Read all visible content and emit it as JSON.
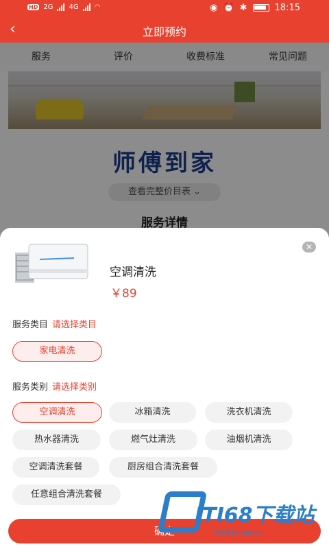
{
  "status_bar": {
    "left_badges": [
      "HD",
      "2G",
      "4G"
    ],
    "time": "18:15"
  },
  "header": {
    "title": "立即预约",
    "back_icon": "chevron-left-icon"
  },
  "tabs": [
    "服务",
    "评价",
    "收费标准",
    "常见问题"
  ],
  "background": {
    "brand_title": "师傅到家",
    "view_list_label": "查看完整价目表 ⌄",
    "section_title": "服务详情"
  },
  "sheet": {
    "product_name": "空调清洗",
    "price": "￥89",
    "category_label": "服务类目",
    "category_hint": "请选择类目",
    "categories": [
      "家电清洗"
    ],
    "type_label": "服务类别",
    "type_hint": "请选择类别",
    "types": [
      "空调清洗",
      "冰箱清洗",
      "洗衣机清洗",
      "热水器清洗",
      "燃气灶清洗",
      "油烟机清洗",
      "空调清洗套餐",
      "厨房组合清洗套餐",
      "任意组合清洗套餐"
    ],
    "selected_type": "空调清洗",
    "confirm_label": "确定"
  },
  "watermark": {
    "text": "ITI68下载站",
    "sub": "IT168 Download"
  },
  "colors": {
    "accent": "#e8412f",
    "brand_blue": "#1d3f8f",
    "watermark_blue": "#2b7ec9"
  }
}
